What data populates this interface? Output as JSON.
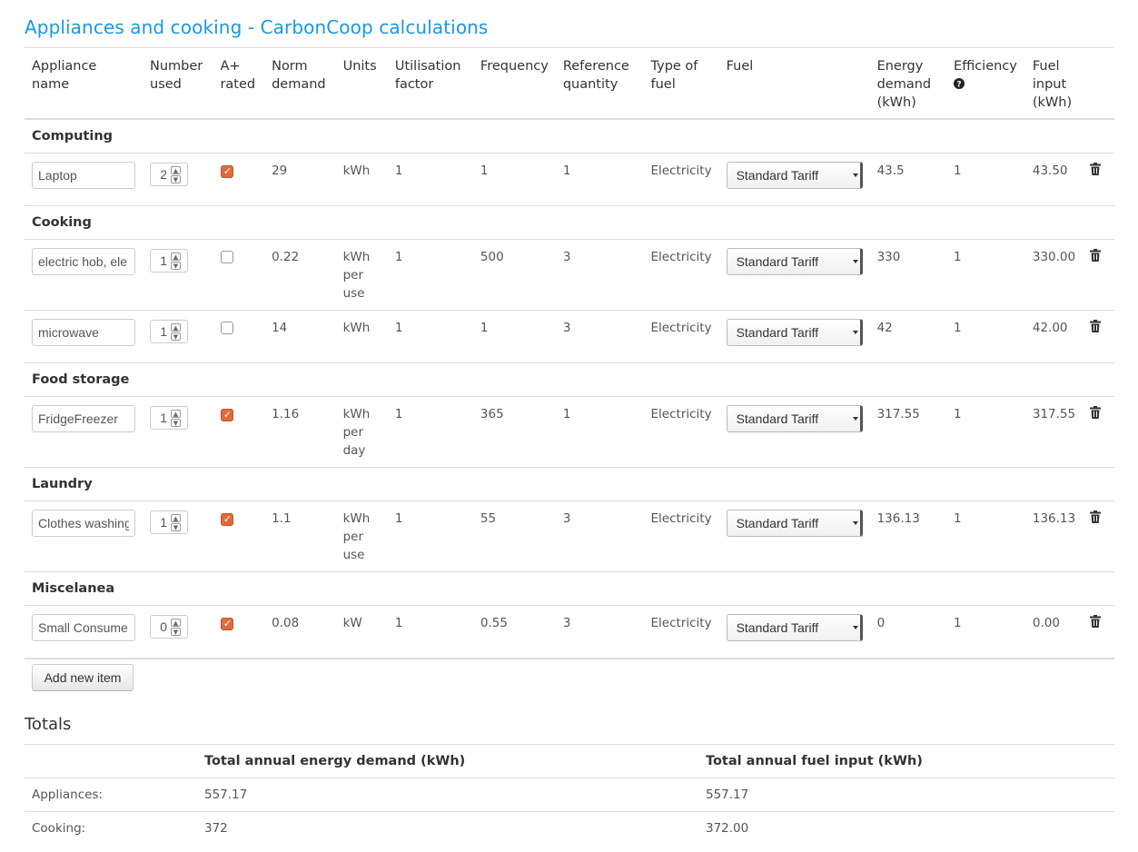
{
  "title": "Appliances and cooking - CarbonCoop calculations",
  "columns": [
    "Appliance name",
    "Number used",
    "A+ rated",
    "Norm demand",
    "Units",
    "Utilisation factor",
    "Frequency",
    "Reference quantity",
    "Type of fuel",
    "Fuel",
    "Energy demand (kWh)",
    "Efficiency",
    "Fuel input (kWh)"
  ],
  "categories": [
    {
      "name": "Computing",
      "items": [
        {
          "appliance": "Laptop",
          "number": "2",
          "a_plus": true,
          "norm": "29",
          "units": "kWh",
          "utilisation": "1",
          "frequency": "1",
          "reference": "1",
          "fuel_type": "Electricity",
          "fuel": "Standard Tariff",
          "energy": "43.5",
          "efficiency": "1",
          "fuel_input": "43.50"
        }
      ]
    },
    {
      "name": "Cooking",
      "items": [
        {
          "appliance": "electric hob, ele",
          "number": "1",
          "a_plus": false,
          "norm": "0.22",
          "units": "kWh per use",
          "utilisation": "1",
          "frequency": "500",
          "reference": "3",
          "fuel_type": "Electricity",
          "fuel": "Standard Tariff",
          "energy": "330",
          "efficiency": "1",
          "fuel_input": "330.00"
        },
        {
          "appliance": "microwave",
          "number": "1",
          "a_plus": false,
          "norm": "14",
          "units": "kWh",
          "utilisation": "1",
          "frequency": "1",
          "reference": "3",
          "fuel_type": "Electricity",
          "fuel": "Standard Tariff",
          "energy": "42",
          "efficiency": "1",
          "fuel_input": "42.00"
        }
      ]
    },
    {
      "name": "Food storage",
      "items": [
        {
          "appliance": "FridgeFreezer",
          "number": "1",
          "a_plus": true,
          "norm": "1.16",
          "units": "kWh per day",
          "utilisation": "1",
          "frequency": "365",
          "reference": "1",
          "fuel_type": "Electricity",
          "fuel": "Standard Tariff",
          "energy": "317.55",
          "efficiency": "1",
          "fuel_input": "317.55"
        }
      ]
    },
    {
      "name": "Laundry",
      "items": [
        {
          "appliance": "Clothes washing",
          "number": "1",
          "a_plus": true,
          "norm": "1.1",
          "units": "kWh per use",
          "utilisation": "1",
          "frequency": "55",
          "reference": "3",
          "fuel_type": "Electricity",
          "fuel": "Standard Tariff",
          "energy": "136.13",
          "efficiency": "1",
          "fuel_input": "136.13"
        }
      ]
    },
    {
      "name": "Miscelanea",
      "items": [
        {
          "appliance": "Small Consume",
          "number": "0",
          "a_plus": true,
          "norm": "0.08",
          "units": "kW",
          "utilisation": "1",
          "frequency": "0.55",
          "reference": "3",
          "fuel_type": "Electricity",
          "fuel": "Standard Tariff",
          "energy": "0",
          "efficiency": "1",
          "fuel_input": "0.00"
        }
      ]
    }
  ],
  "add_item_label": "Add new item",
  "totals": {
    "heading": "Totals",
    "col_energy": "Total annual energy demand (kWh)",
    "col_fuel": "Total annual fuel input (kWh)",
    "rows": [
      {
        "label": "Appliances:",
        "energy": "557.17",
        "fuel": "557.17"
      },
      {
        "label": "Cooking:",
        "energy": "372",
        "fuel": "372.00"
      }
    ]
  },
  "colors": {
    "title": "#1a98e0",
    "checkbox_checked": "#e06b3b",
    "border": "#dddddd"
  },
  "icons": {
    "delete": "trash-icon",
    "efficiency_help": "question-circle-icon"
  }
}
